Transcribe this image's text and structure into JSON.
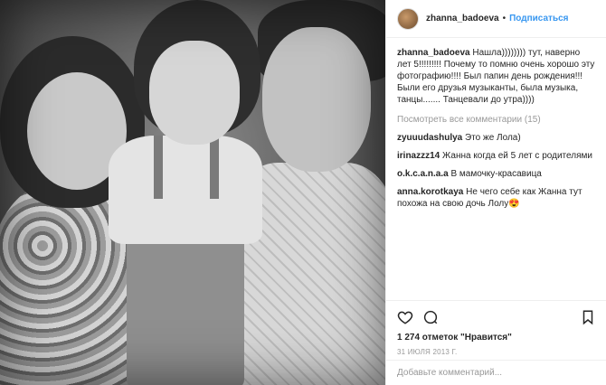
{
  "header": {
    "username": "zhanna_badoeva",
    "separator": "•",
    "follow_label": "Подписаться"
  },
  "caption": {
    "author": "zhanna_badoeva",
    "text": "Нашла)))))))) тут, наверно лет 5!!!!!!!!! Почему то помню очень хорошо эту фотографию!!!! Был папин день рождения!!! Были его друзья музыканты, была музыка, танцы....... Танцевали до утра))))"
  },
  "view_all_label": "Посмотреть все комментарии (15)",
  "comments": [
    {
      "user": "zyuuudashulya",
      "text": "Это же Лола)"
    },
    {
      "user": "irinazzz14",
      "text": "Жанна когда ей 5 лет с родителями"
    },
    {
      "user": "o.k.c.a.n.a.a",
      "text": "В мамочку-красавица"
    },
    {
      "user": "anna.korotkaya",
      "text": "Не чего себе как Жанна тут похожа на свою дочь Лолу😍"
    }
  ],
  "likes_text": "1 274 отметок \"Нравится\"",
  "date_text": "31 ИЮЛЯ 2013 Г.",
  "add_comment_placeholder": "Добавьте комментарий...",
  "icons": [
    "heart-icon",
    "comment-icon",
    "bookmark-icon"
  ],
  "colors": {
    "accent": "#3897f0",
    "muted": "#999999",
    "text": "#262626",
    "border": "#efefef"
  }
}
